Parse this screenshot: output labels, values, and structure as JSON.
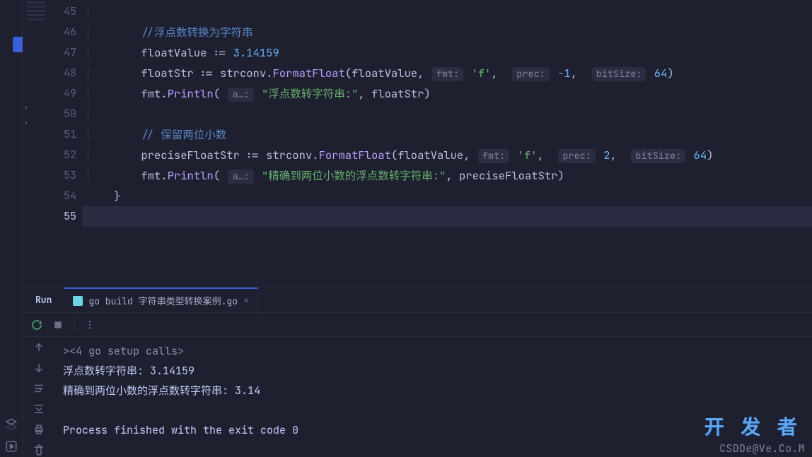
{
  "editor": {
    "lines": {
      "start": 45,
      "current": 55,
      "l46_comment": "//浮点数转换为字符串",
      "l47": {
        "var": "floatValue",
        "op": ":=",
        "val": "3.14159"
      },
      "l48": {
        "var": "floatStr",
        "op": ":=",
        "pkgfn": "strconv",
        "fn": "FormatFloat",
        "args_plain": "floatValue,",
        "hint_fmt_label": "fmt:",
        "hint_fmt_val": "'f'",
        "sep1": ",",
        "hint_prec_label": "prec:",
        "hint_prec_val": "-1",
        "sep2": ",",
        "hint_bs_label": "bitSize:",
        "hint_bs_val": "64",
        "close": ")"
      },
      "l49": {
        "pkg": "fmt",
        "fn": "Println",
        "hint_a": "a…:",
        "str": "\"浮点数转字符串:\"",
        "arg2": ", floatStr)"
      },
      "l51_comment": "// 保留两位小数",
      "l52": {
        "var": "preciseFloatStr",
        "op": ":=",
        "pkgfn": "strconv",
        "fn": "FormatFloat",
        "args_plain": "floatValue,",
        "hint_fmt_label": "fmt:",
        "hint_fmt_val": "'f'",
        "sep1": ",",
        "hint_prec_label": "prec:",
        "hint_prec_val": "2",
        "sep2": ",",
        "hint_bs_label": "bitSize:",
        "hint_bs_val": "64",
        "close": ")"
      },
      "l53": {
        "pkg": "fmt",
        "fn": "Println",
        "hint_a": "a…:",
        "str": "\"精确到两位小数的浮点数转字符串:\"",
        "arg2": ", preciseFloatStr)"
      },
      "l54_brace": "}"
    }
  },
  "run": {
    "tab_label": "Run",
    "file_tab": "go build 字符串类型转换案例.go",
    "output": {
      "collapse_label": "><4 go setup calls>",
      "line1": "浮点数转字符串: 3.14159",
      "line2": "精确到两位小数的浮点数转字符串: 3.14",
      "finished": "Process finished with the exit code 0"
    }
  },
  "watermark": {
    "title": "开 发 者",
    "sub": "CSDDe@Ve.Co.M"
  }
}
